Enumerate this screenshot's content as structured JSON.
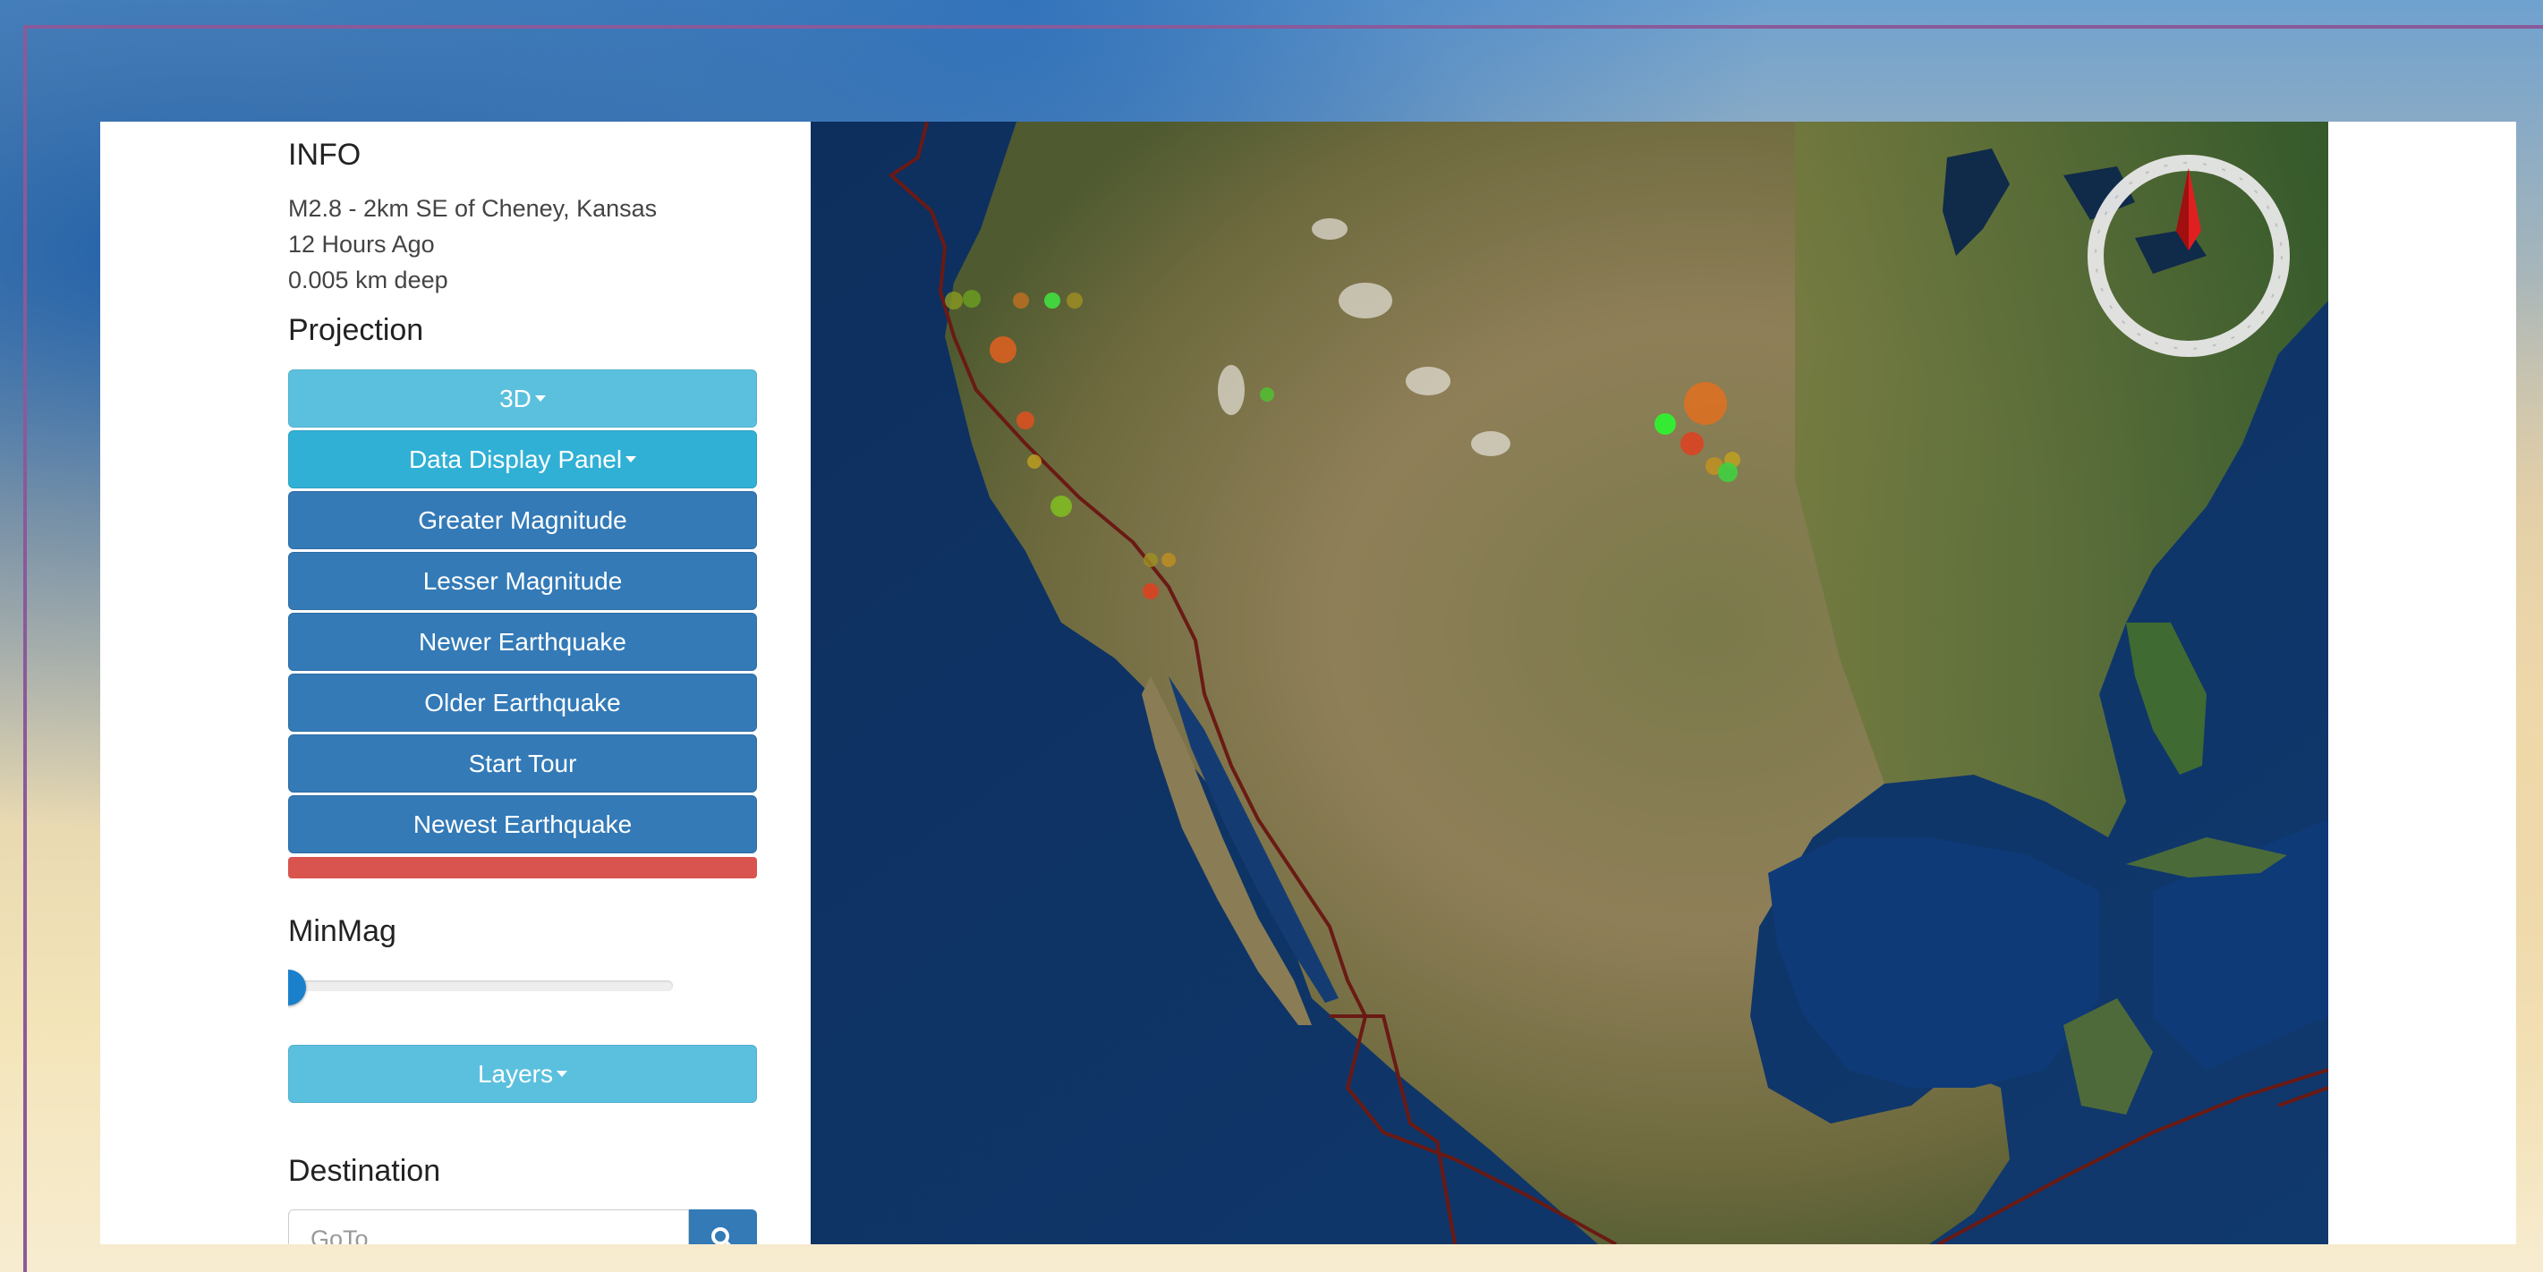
{
  "info": {
    "heading": "INFO",
    "title": "M2.8 - 2km SE of Cheney, Kansas",
    "time": "12 Hours Ago",
    "depth": "0.005 km deep"
  },
  "projection": {
    "heading": "Projection",
    "mode_label": "3D",
    "data_panel_label": "Data Display Panel",
    "buttons": [
      "Greater Magnitude",
      "Lesser Magnitude",
      "Newer Earthquake",
      "Older Earthquake",
      "Start Tour",
      "Newest Earthquake"
    ]
  },
  "minmag": {
    "heading": "MinMag",
    "value_fraction": 0
  },
  "layers": {
    "label": "Layers"
  },
  "destination": {
    "heading": "Destination",
    "placeholder": "GoTo"
  },
  "colors": {
    "btn_info": "#5bc0de",
    "btn_info_active": "#31b0d5",
    "btn_primary": "#337ab7",
    "danger": "#d9534f",
    "slider_handle": "#1a80cc",
    "compass_needle": "#e02020"
  },
  "icons": [
    "search-icon",
    "compass-icon",
    "caret-down-icon",
    "slider-handle"
  ]
}
